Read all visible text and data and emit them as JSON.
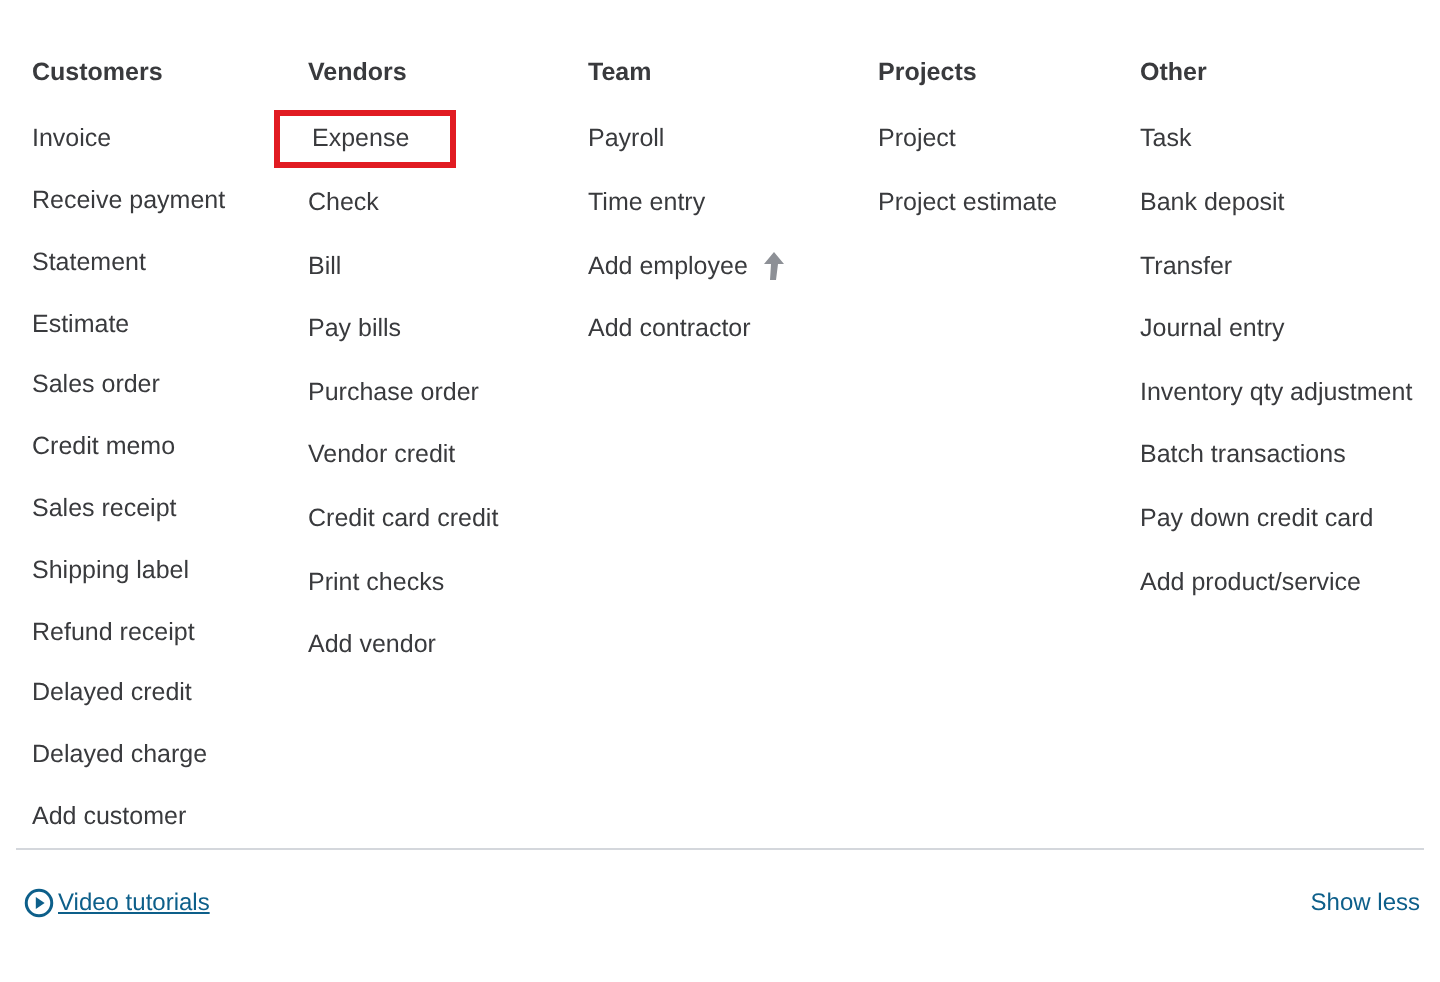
{
  "columns": [
    {
      "title": "Customers",
      "items": [
        {
          "label": "Invoice",
          "highlighted": false,
          "upgrade": false
        },
        {
          "label": "Receive payment",
          "highlighted": false,
          "upgrade": false
        },
        {
          "label": "Statement",
          "highlighted": false,
          "upgrade": false
        },
        {
          "label": "Estimate",
          "highlighted": false,
          "upgrade": false
        },
        {
          "label": "Sales order",
          "highlighted": false,
          "upgrade": false
        },
        {
          "label": "Credit memo",
          "highlighted": false,
          "upgrade": false
        },
        {
          "label": "Sales receipt",
          "highlighted": false,
          "upgrade": false
        },
        {
          "label": "Shipping label",
          "highlighted": false,
          "upgrade": false
        },
        {
          "label": "Refund receipt",
          "highlighted": false,
          "upgrade": false
        },
        {
          "label": "Delayed credit",
          "highlighted": false,
          "upgrade": false
        },
        {
          "label": "Delayed charge",
          "highlighted": false,
          "upgrade": false
        },
        {
          "label": "Add customer",
          "highlighted": false,
          "upgrade": false
        }
      ]
    },
    {
      "title": "Vendors",
      "items": [
        {
          "label": "Expense",
          "highlighted": true,
          "upgrade": false
        },
        {
          "label": "Check",
          "highlighted": false,
          "upgrade": false
        },
        {
          "label": "Bill",
          "highlighted": false,
          "upgrade": false
        },
        {
          "label": "Pay bills",
          "highlighted": false,
          "upgrade": false
        },
        {
          "label": "Purchase order",
          "highlighted": false,
          "upgrade": false
        },
        {
          "label": "Vendor credit",
          "highlighted": false,
          "upgrade": false
        },
        {
          "label": "Credit card credit",
          "highlighted": false,
          "upgrade": false
        },
        {
          "label": "Print checks",
          "highlighted": false,
          "upgrade": false
        },
        {
          "label": "Add vendor",
          "highlighted": false,
          "upgrade": false
        }
      ]
    },
    {
      "title": "Team",
      "items": [
        {
          "label": "Payroll",
          "highlighted": false,
          "upgrade": false
        },
        {
          "label": "Time entry",
          "highlighted": false,
          "upgrade": false
        },
        {
          "label": "Add employee",
          "highlighted": false,
          "upgrade": true
        },
        {
          "label": "Add contractor",
          "highlighted": false,
          "upgrade": false
        }
      ]
    },
    {
      "title": "Projects",
      "items": [
        {
          "label": "Project",
          "highlighted": false,
          "upgrade": false
        },
        {
          "label": "Project estimate",
          "highlighted": false,
          "upgrade": false
        }
      ]
    },
    {
      "title": "Other",
      "items": [
        {
          "label": "Task",
          "highlighted": false,
          "upgrade": false
        },
        {
          "label": "Bank deposit",
          "highlighted": false,
          "upgrade": false
        },
        {
          "label": "Transfer",
          "highlighted": false,
          "upgrade": false
        },
        {
          "label": "Journal entry",
          "highlighted": false,
          "upgrade": false
        },
        {
          "label": "Inventory qty adjustment",
          "highlighted": false,
          "upgrade": false
        },
        {
          "label": "Batch transactions",
          "highlighted": false,
          "upgrade": false
        },
        {
          "label": "Pay down credit card",
          "highlighted": false,
          "upgrade": false
        },
        {
          "label": "Add product/service",
          "highlighted": false,
          "upgrade": false
        }
      ]
    }
  ],
  "footer": {
    "video_link": "Video tutorials",
    "show_less": "Show less"
  }
}
